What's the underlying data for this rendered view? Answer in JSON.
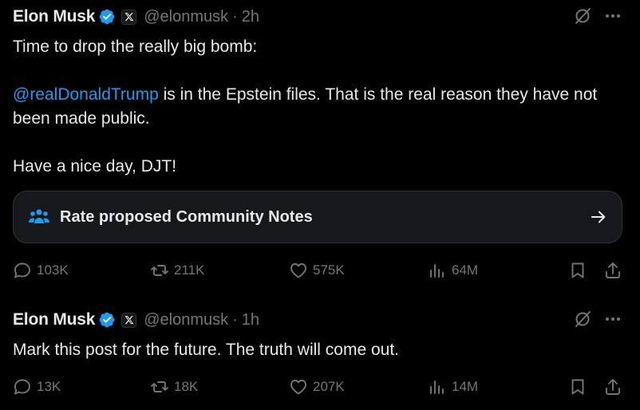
{
  "tweets": [
    {
      "author": "Elon Musk",
      "handle": "@elonmusk",
      "separator": "·",
      "time": "2h",
      "text": {
        "line1": "Time to drop the really big bomb:",
        "mention": "@realDonaldTrump",
        "line2": " is in the Epstein files. That is the real reason they have not been made public.",
        "line3": "Have a nice day, DJT!"
      },
      "community_notes_label": "Rate proposed Community Notes",
      "stats": {
        "replies": "103K",
        "reposts": "211K",
        "likes": "575K",
        "views": "64M"
      }
    },
    {
      "author": "Elon Musk",
      "handle": "@elonmusk",
      "separator": "·",
      "time": "1h",
      "text": {
        "line1": "Mark this post for the future. The truth will come out."
      },
      "stats": {
        "replies": "13K",
        "reposts": "18K",
        "likes": "207K",
        "views": "14M"
      }
    }
  ],
  "colors": {
    "background": "#000000",
    "text": "#e7e9ea",
    "muted": "#71767b",
    "accent": "#1d9bf0"
  },
  "icons": [
    "verified-badge-icon",
    "x-logo-icon",
    "grok-icon",
    "more-icon",
    "community-notes-icon",
    "arrow-right-icon",
    "reply-icon",
    "repost-icon",
    "like-icon",
    "views-icon",
    "bookmark-icon",
    "share-icon"
  ]
}
